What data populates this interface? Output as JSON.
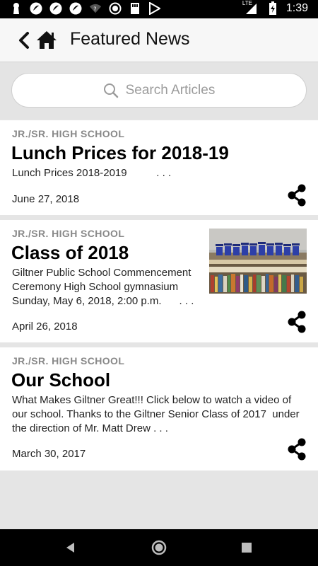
{
  "statusbar": {
    "time": "1:39",
    "network": "LTE",
    "icons": [
      "keyhole-icon",
      "app-icon",
      "app-icon",
      "app-icon",
      "wifi-question-icon",
      "circle-icon",
      "sd-card-icon",
      "play-store-icon",
      "signal-icon",
      "battery-charging-icon"
    ]
  },
  "header": {
    "title": "Featured News",
    "back_icon": "chevron-left-icon",
    "home_icon": "home-icon"
  },
  "search": {
    "placeholder": "Search Articles",
    "icon": "search-icon"
  },
  "articles": [
    {
      "category": "JR./SR. HIGH SCHOOL",
      "title": "Lunch Prices for 2018-19",
      "excerpt": "Lunch Prices 2018-2019          . . .",
      "date": "June 27, 2018",
      "has_image": false
    },
    {
      "category": "JR./SR. HIGH SCHOOL",
      "title": "Class of 2018",
      "excerpt": "Giltner Public School Commencement Ceremony High School gymnasium Sunday, May 6, 2018, 2:00 p.m.      . . .",
      "date": "April 26, 2018",
      "has_image": true
    },
    {
      "category": "JR./SR. HIGH SCHOOL",
      "title": "Our School",
      "excerpt": "What Makes Giltner Great!!! Click below to watch a video of our school. Thanks to the Giltner Senior Class of 2017  under the direction of Mr. Matt Drew . . .",
      "date": "March 30, 2017",
      "has_image": false
    }
  ],
  "colors": {
    "background": "#e5e5e5",
    "header_bg": "#f7f7f7",
    "category_text": "#888888",
    "title_text": "#000000"
  },
  "navbar": {
    "buttons": [
      "back-triangle-icon",
      "home-circle-icon",
      "recents-square-icon"
    ]
  }
}
